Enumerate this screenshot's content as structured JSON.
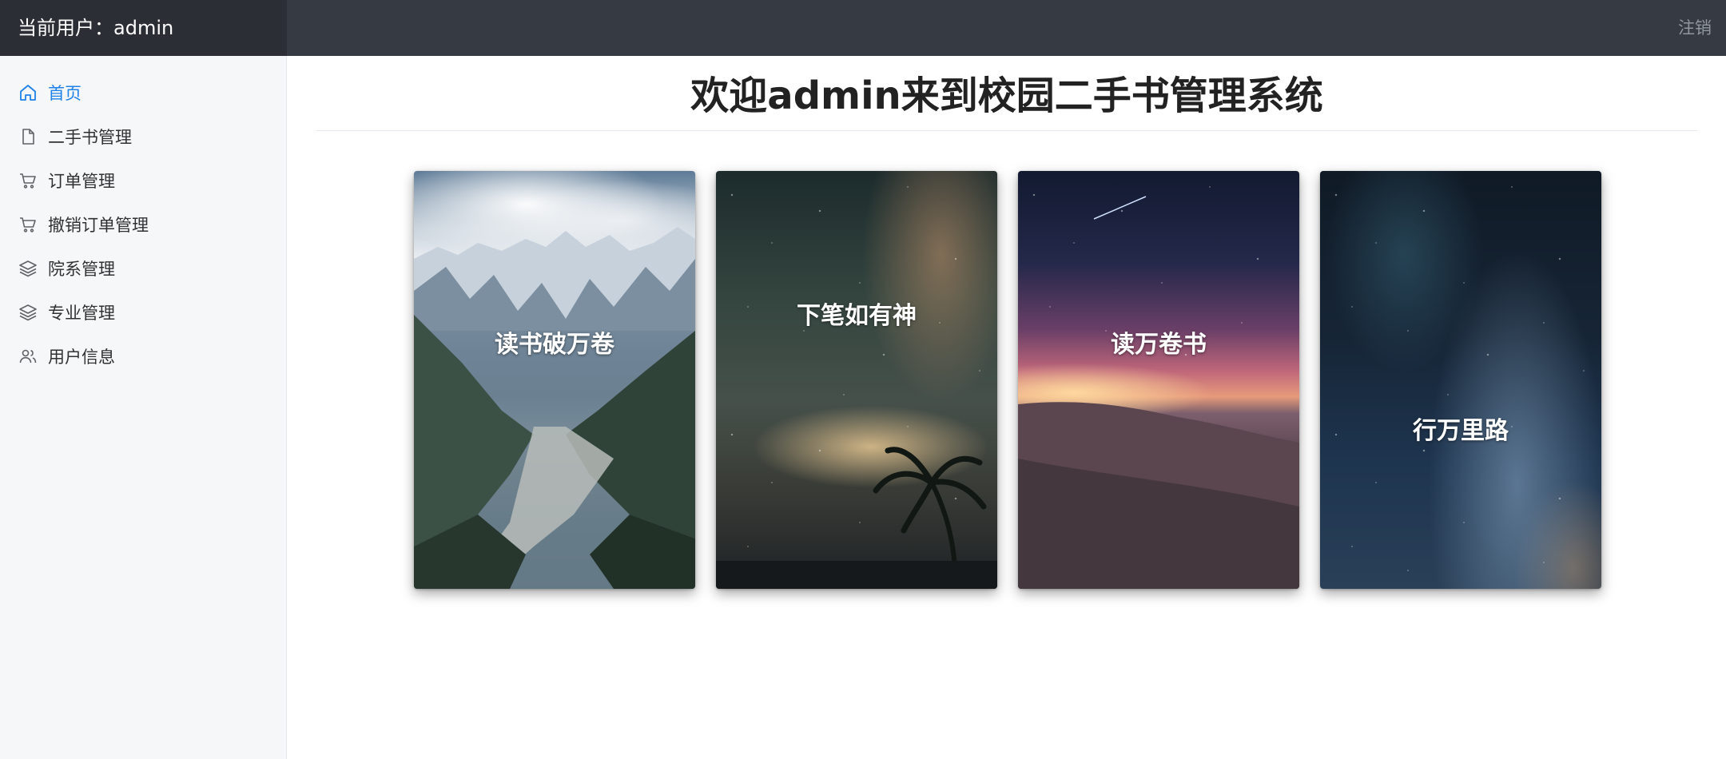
{
  "header": {
    "current_user": "当前用户：admin",
    "logout_label": "注销"
  },
  "sidebar": {
    "items": [
      {
        "label": "首页",
        "icon": "home-icon",
        "active": true
      },
      {
        "label": "二手书管理",
        "icon": "document-icon",
        "active": false
      },
      {
        "label": "订单管理",
        "icon": "cart-icon",
        "active": false
      },
      {
        "label": "撤销订单管理",
        "icon": "cart-icon",
        "active": false
      },
      {
        "label": "院系管理",
        "icon": "layers-icon",
        "active": false
      },
      {
        "label": "专业管理",
        "icon": "layers-icon",
        "active": false
      },
      {
        "label": "用户信息",
        "icon": "users-icon",
        "active": false
      }
    ]
  },
  "main": {
    "welcome_prefix": "欢迎",
    "welcome_user": "admin",
    "welcome_suffix": "来到校园二手书管理系统",
    "cards": [
      {
        "caption": "读书破万卷",
        "image": "mountain-glacier-image"
      },
      {
        "caption": "下笔如有神",
        "image": "night-sky-palm-image"
      },
      {
        "caption": "读万卷书",
        "image": "desert-sunset-image"
      },
      {
        "caption": "行万里路",
        "image": "milky-way-image"
      }
    ]
  },
  "colors": {
    "header_bg": "#363a42",
    "header_user_bg": "#2b2f35",
    "sidebar_bg": "#f6f7f9",
    "active": "#1e82e8"
  }
}
